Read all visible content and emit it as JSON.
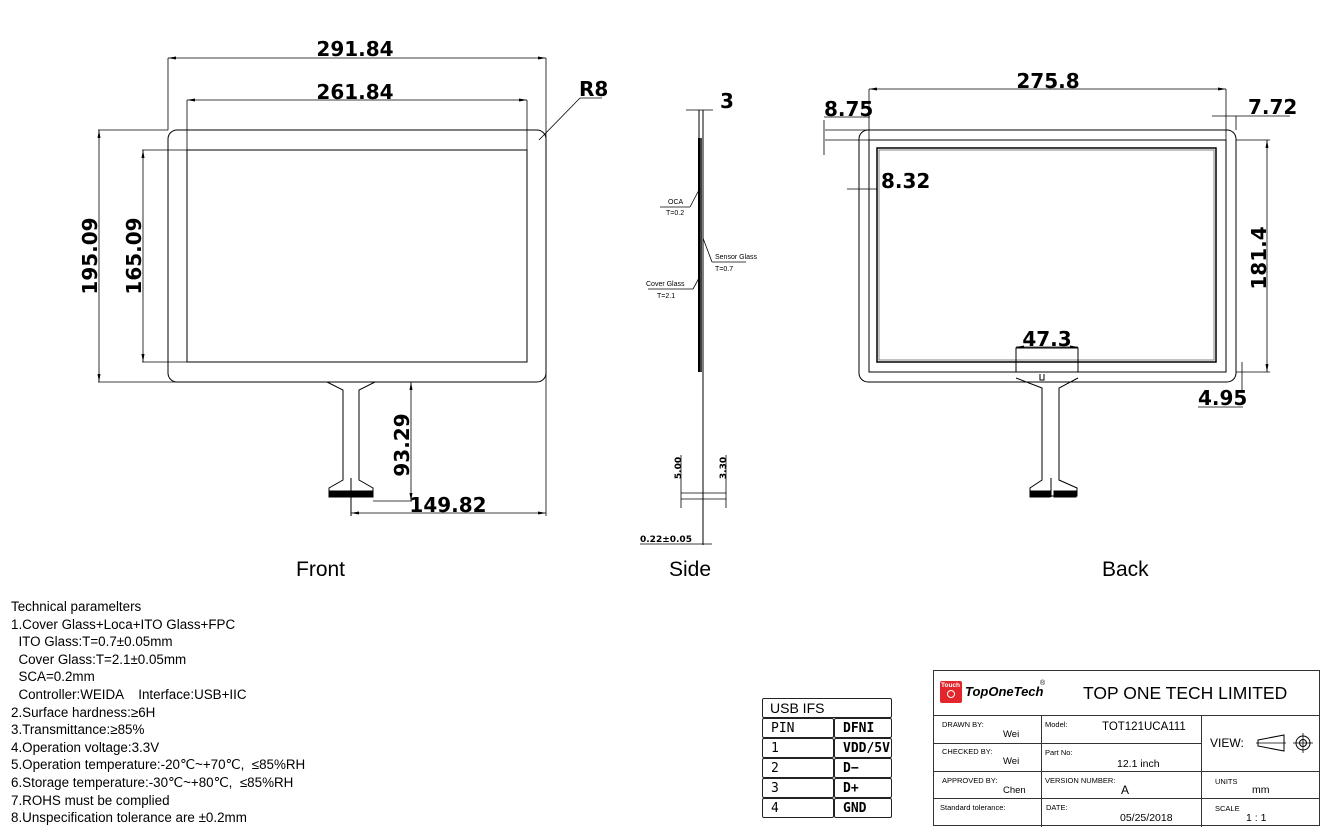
{
  "views": {
    "front": {
      "caption": "Front",
      "dims": {
        "overall_width": "291.84",
        "active_width": "261.84",
        "corner_radius": "R8",
        "overall_height": "195.09",
        "active_height": "165.09",
        "fpc_length": "93.29",
        "fpc_offset": "149.82"
      }
    },
    "side": {
      "caption": "Side",
      "dims": {
        "thickness": "3",
        "fpc_a": "5.00",
        "fpc_b": "3.30",
        "fpc_thickness": "0.22±0.05"
      },
      "layers": [
        {
          "name": "OCA",
          "thickness": "T=0.2"
        },
        {
          "name": "Sensor Glass",
          "thickness": "T=0.7"
        },
        {
          "name": "Cover Glass",
          "thickness": "T=2.1"
        }
      ]
    },
    "back": {
      "caption": "Back",
      "dims": {
        "sensor_width": "275.8",
        "left_margin": "8.75",
        "right_margin": "7.72",
        "inner_margin": "8.32",
        "sensor_height": "181.4",
        "fpc_width": "47.3",
        "bottom_margin": "4.95"
      }
    }
  },
  "specs": {
    "title": "Technical paramelters",
    "lines": [
      "1.Cover Glass+Loca+ITO Glass+FPC",
      "  ITO Glass:T=0.7±0.05mm",
      "  Cover Glass:T=2.1±0.05mm",
      "  SCA=0.2mm",
      "  Controller:WEIDA    Interface:USB+IIC",
      "2.Surface hardness:≥6H",
      "3.Transmittance:≥85%",
      "4.Operation voltage:3.3V",
      "5.Operation temperature:-20℃~+70℃,  ≤85%RH",
      "6.Storage temperature:-30℃~+80℃,  ≤85%RH",
      "7.ROHS must be complied",
      "8.Unspecification tolerance are ±0.2mm"
    ]
  },
  "usb_table": {
    "title": "USB IFS",
    "headers": [
      "PIN",
      "DFNI"
    ],
    "rows": [
      [
        "1",
        "VDD/5V"
      ],
      [
        "2",
        "D−"
      ],
      [
        "3",
        "D+"
      ],
      [
        "4",
        "GND"
      ]
    ]
  },
  "title_block": {
    "logo_badge": "Touch",
    "brand": "TopOneTech",
    "registered": "®",
    "company": "TOP ONE TECH LIMITED",
    "drawn_by_label": "DRAWN BY:",
    "drawn_by": "Wei",
    "checked_by_label": "CHECKED BY:",
    "checked_by": "Wei",
    "approved_by_label": "APPROVED BY:",
    "approved_by": "Chen",
    "tolerance_label": "Standard tolerance:",
    "model_label": "Model:",
    "model": "TOT121UCA111",
    "part_label": "Part No:",
    "part": "12.1 inch",
    "version_label": "VERSION NUMBER:",
    "version": "A",
    "date_label": "DATE:",
    "date": "05/25/2018",
    "view_label": "VIEW:",
    "units_label": "UNITS",
    "units": "mm",
    "scale_label": "SCALE",
    "scale": "1 : 1",
    "brand_color": "#e3262b"
  }
}
